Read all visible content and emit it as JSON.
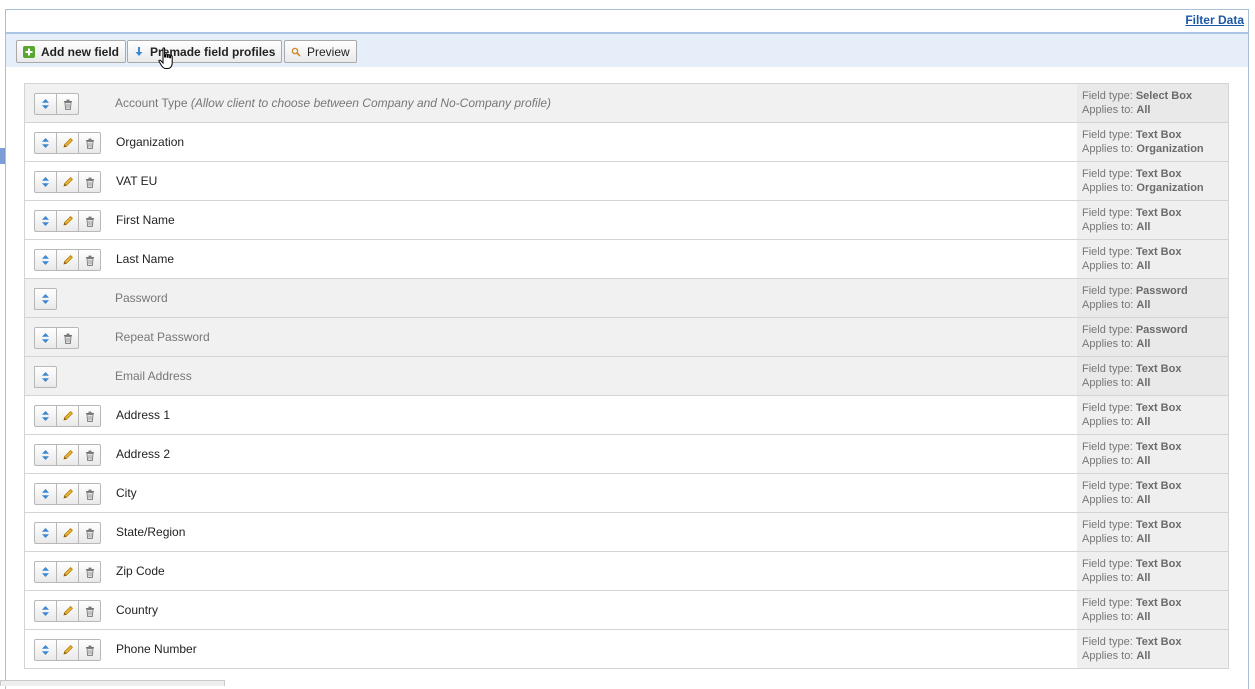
{
  "header": {
    "filter_link": "Filter Data"
  },
  "toolbar": {
    "add_label": "Add new field",
    "premade_label": "Premade field profiles",
    "preview_label": "Preview"
  },
  "meta_labels": {
    "type_prefix": "Field type: ",
    "applies_prefix": "Applies to: "
  },
  "colors": {
    "accent": "#1c57a8",
    "toolbar_bg": "#e6eff9",
    "row_locked": "#f1f1f1",
    "meta_bg": "#efefef",
    "add_icon": "#5aa632"
  },
  "icons": {
    "move": "up-down-arrows-icon",
    "edit": "pencil-icon",
    "delete": "trash-icon"
  },
  "fields": [
    {
      "label": "Account Type",
      "note": "(Allow client to choose between Company and No-Company profile)",
      "type": "Select Box",
      "applies": "All",
      "locked": true,
      "actions": [
        "move",
        "delete"
      ]
    },
    {
      "label": "Organization",
      "type": "Text Box",
      "applies": "Organization",
      "locked": false,
      "actions": [
        "move",
        "edit",
        "delete"
      ]
    },
    {
      "label": "VAT EU",
      "type": "Text Box",
      "applies": "Organization",
      "locked": false,
      "actions": [
        "move",
        "edit",
        "delete"
      ]
    },
    {
      "label": "First Name",
      "type": "Text Box",
      "applies": "All",
      "locked": false,
      "actions": [
        "move",
        "edit",
        "delete"
      ]
    },
    {
      "label": "Last Name",
      "type": "Text Box",
      "applies": "All",
      "locked": false,
      "actions": [
        "move",
        "edit",
        "delete"
      ]
    },
    {
      "label": "Password",
      "type": "Password",
      "applies": "All",
      "locked": true,
      "actions": [
        "move"
      ]
    },
    {
      "label": "Repeat Password",
      "type": "Password",
      "applies": "All",
      "locked": true,
      "actions": [
        "move",
        "delete"
      ]
    },
    {
      "label": "Email Address",
      "type": "Text Box",
      "applies": "All",
      "locked": true,
      "actions": [
        "move"
      ]
    },
    {
      "label": "Address 1",
      "type": "Text Box",
      "applies": "All",
      "locked": false,
      "actions": [
        "move",
        "edit",
        "delete"
      ]
    },
    {
      "label": "Address 2",
      "type": "Text Box",
      "applies": "All",
      "locked": false,
      "actions": [
        "move",
        "edit",
        "delete"
      ]
    },
    {
      "label": "City",
      "type": "Text Box",
      "applies": "All",
      "locked": false,
      "actions": [
        "move",
        "edit",
        "delete"
      ]
    },
    {
      "label": "State/Region",
      "type": "Text Box",
      "applies": "All",
      "locked": false,
      "actions": [
        "move",
        "edit",
        "delete"
      ]
    },
    {
      "label": "Zip Code",
      "type": "Text Box",
      "applies": "All",
      "locked": false,
      "actions": [
        "move",
        "edit",
        "delete"
      ]
    },
    {
      "label": "Country",
      "type": "Text Box",
      "applies": "All",
      "locked": false,
      "actions": [
        "move",
        "edit",
        "delete"
      ]
    },
    {
      "label": "Phone Number",
      "type": "Text Box",
      "applies": "All",
      "locked": false,
      "actions": [
        "move",
        "edit",
        "delete"
      ]
    }
  ]
}
